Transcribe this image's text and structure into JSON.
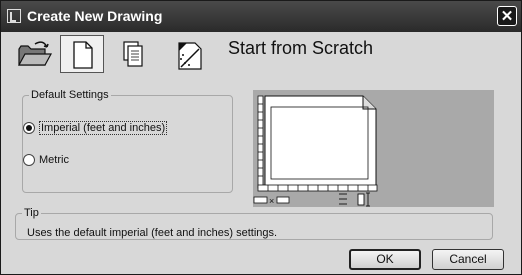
{
  "window": {
    "title": "Create New Drawing"
  },
  "toolbar": {
    "buttons": [
      {
        "name": "open-drawing",
        "icon": "folder-open-icon"
      },
      {
        "name": "start-from-scratch",
        "icon": "blank-page-icon",
        "active": true
      },
      {
        "name": "use-template",
        "icon": "template-pages-icon"
      },
      {
        "name": "use-wizard",
        "icon": "wizard-icon"
      }
    ]
  },
  "heading": "Start from Scratch",
  "default_settings": {
    "legend": "Default Settings",
    "options": [
      {
        "label": "Imperial (feet and inches)",
        "selected": true
      },
      {
        "label": "Metric",
        "selected": false
      }
    ]
  },
  "preview": {
    "unit_glyphs": {
      "x": "×"
    }
  },
  "tip": {
    "legend": "Tip",
    "text": "Uses the default imperial (feet and inches) settings."
  },
  "buttons": {
    "ok": "OK",
    "cancel": "Cancel"
  }
}
